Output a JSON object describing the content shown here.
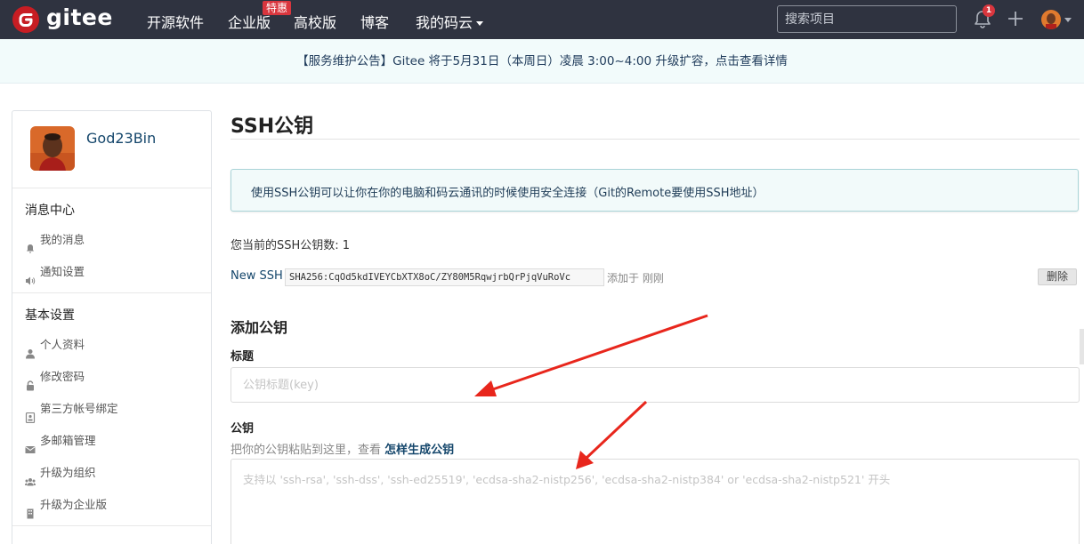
{
  "nav": {
    "logo_text": "gitee",
    "links": [
      "开源软件",
      "企业版",
      "高校版",
      "博客",
      "我的码云"
    ],
    "hot_badge": "特惠",
    "search_placeholder": "搜索项目",
    "notification_count": "1",
    "colors": {
      "bar": "#2f3340",
      "brand": "#c71d23",
      "badge": "#d9363e"
    }
  },
  "announcement": "【服务维护公告】Gitee 将于5月31日（本周日）凌晨 3:00~4:00 升级扩容，点击查看详情",
  "sidebar": {
    "username": "God23Bin",
    "sections": [
      {
        "title": "消息中心",
        "items": [
          {
            "label": "我的消息",
            "icon": "bell-icon"
          },
          {
            "label": "通知设置",
            "icon": "speaker-icon"
          }
        ]
      },
      {
        "title": "基本设置",
        "items": [
          {
            "label": "个人资料",
            "icon": "user-icon"
          },
          {
            "label": "修改密码",
            "icon": "lock-icon"
          },
          {
            "label": "第三方帐号绑定",
            "icon": "id-card-icon"
          },
          {
            "label": "多邮箱管理",
            "icon": "envelope-icon"
          },
          {
            "label": "升级为组织",
            "icon": "group-icon"
          },
          {
            "label": "升级为企业版",
            "icon": "building-icon"
          }
        ]
      }
    ]
  },
  "main": {
    "title": "SSH公钥",
    "info": "使用SSH公钥可以让你在你的电脑和码云通讯的时候使用安全连接（Git的Remote要使用SSH地址）",
    "count_line": "您当前的SSH公钥数: 1",
    "keys": [
      {
        "name": "New SSH",
        "fingerprint": "SHA256:CqOd5kdIVEYCbXTX8oC/ZY80M5RqwjrbQrPjqVuRoVc",
        "added": "添加于 刚刚",
        "delete_label": "删除"
      }
    ],
    "add_title": "添加公钥",
    "title_label": "标题",
    "title_placeholder": "公钥标题(key)",
    "key_label": "公钥",
    "key_hint": "把你的公钥粘贴到这里，查看",
    "key_hint_link": "怎样生成公钥",
    "key_placeholder": "支持以 'ssh-rsa', 'ssh-dss', 'ssh-ed25519', 'ecdsa-sha2-nistp256', 'ecdsa-sha2-nistp384' or 'ecdsa-sha2-nistp521' 开头"
  },
  "annotation_arrow_color": "#e8261c"
}
